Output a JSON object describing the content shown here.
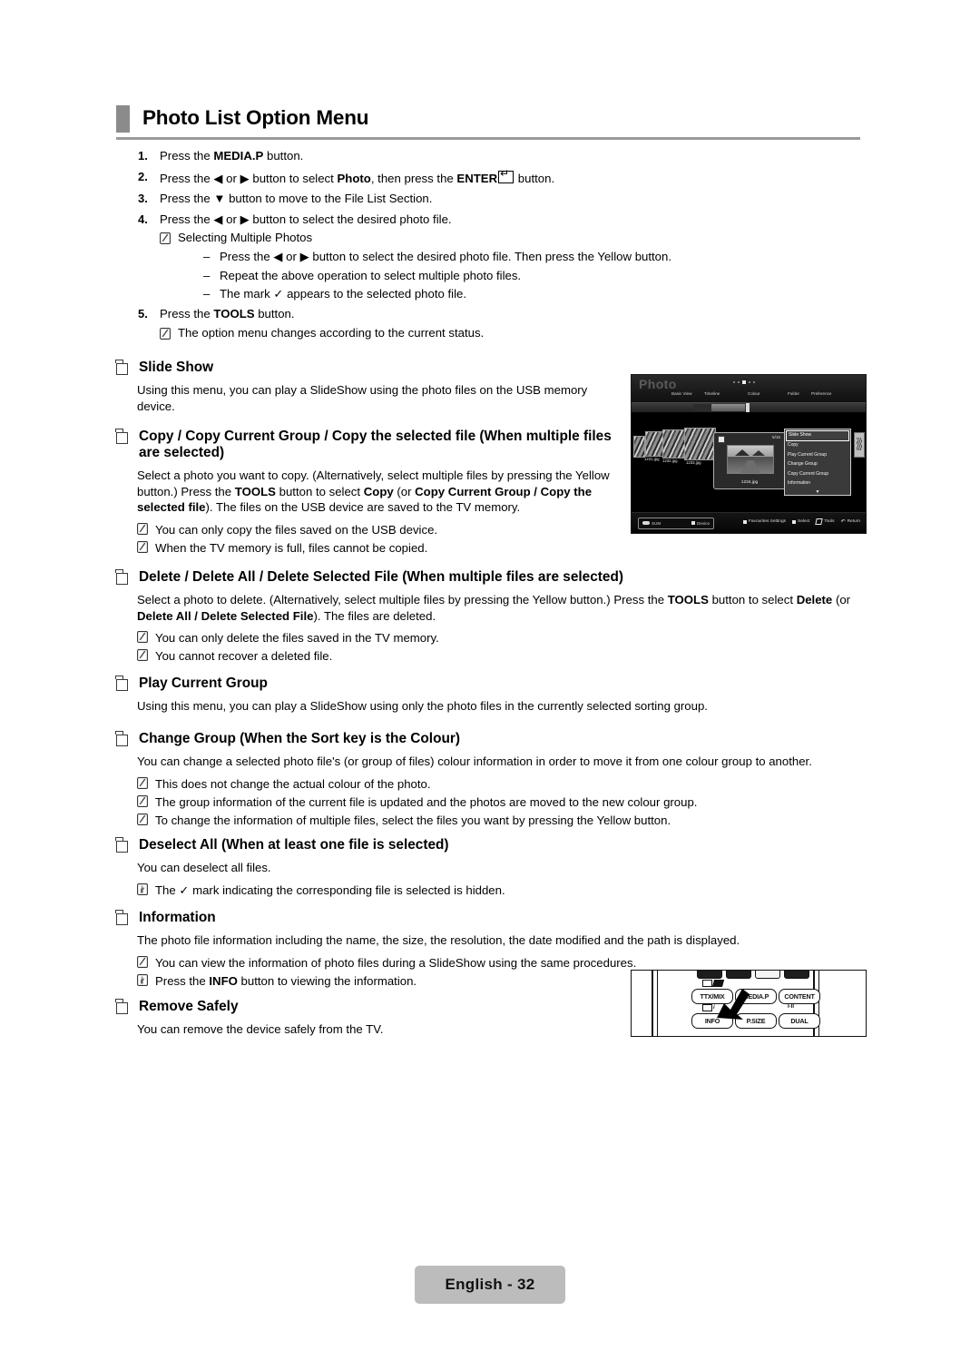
{
  "header": {
    "title": "Photo List Option Menu"
  },
  "steps": [
    {
      "num": "1.",
      "segments": [
        {
          "t": "Press the ",
          "b": false
        },
        {
          "t": "MEDIA.P",
          "b": true
        },
        {
          "t": " button.",
          "b": false
        }
      ]
    },
    {
      "num": "2.",
      "segments": [
        {
          "t": "Press the ",
          "b": false
        },
        {
          "t": "◀",
          "b": false
        },
        {
          "t": " or ",
          "b": false
        },
        {
          "t": "▶",
          "b": false
        },
        {
          "t": " button to select ",
          "b": false
        },
        {
          "t": "Photo",
          "b": true
        },
        {
          "t": ", then press the ",
          "b": false
        },
        {
          "t": "ENTER",
          "b": true
        },
        {
          "t": "ICON_ENTER",
          "b": false
        },
        {
          "t": " button.",
          "b": false
        }
      ]
    },
    {
      "num": "3.",
      "segments": [
        {
          "t": "Press the ",
          "b": false
        },
        {
          "t": "▼",
          "b": false
        },
        {
          "t": " button to move to the File List Section.",
          "b": false
        }
      ]
    },
    {
      "num": "4.",
      "segments": [
        {
          "t": "Press the ",
          "b": false
        },
        {
          "t": "◀",
          "b": false
        },
        {
          "t": " or ",
          "b": false
        },
        {
          "t": "▶",
          "b": false
        },
        {
          "t": " button to select the desired photo file.",
          "b": false
        }
      ]
    }
  ],
  "step4_note": "Selecting Multiple Photos",
  "step4_dashes": [
    "Press the ◀ or ▶ button to select the desired photo file. Then press the Yellow button.",
    "Repeat the above operation to select multiple photo files.",
    "The mark ✓ appears to the selected photo file."
  ],
  "step5": {
    "num": "5.",
    "pre": "Press the ",
    "bold": "TOOLS",
    "post": " button.",
    "note": "The option menu changes according to the current status."
  },
  "sections": [
    {
      "id": "slide-show",
      "title": "Slide Show",
      "body": "Using this menu, you can play a SlideShow using the photo files on the USB memory device.",
      "notes": []
    },
    {
      "id": "copy",
      "title": "Copy / Copy Current Group / Copy the selected file (When multiple files are selected)",
      "body": "Select a photo you want to copy. (Alternatively, select multiple files by pressing the Yellow button.) Press the TOOLS button to select Copy (or Copy Current Group / Copy the selected file). The files on the USB device are saved to the TV memory.",
      "notes": [
        "You can only copy the files saved on the USB device.",
        "When the TV memory is full, files cannot be copied."
      ]
    },
    {
      "id": "delete",
      "title": "Delete / Delete All / Delete Selected File (When multiple files are selected)",
      "body": "Select a photo to delete. (Alternatively, select multiple files by pressing the Yellow button.) Press the TOOLS button to select Delete (or Delete All / Delete Selected File). The files are deleted.",
      "notes": [
        "You can only delete the files saved in the TV memory.",
        "You cannot recover a deleted file."
      ]
    },
    {
      "id": "play-current-group",
      "title": "Play Current Group",
      "body": "Using this menu, you can play a SlideShow using only the photo files in the currently selected sorting group.",
      "notes": []
    },
    {
      "id": "change-group",
      "title": "Change Group (When the Sort key is the Colour)",
      "body": "You can change a selected photo file's (or group of files) colour information in order to move it from one colour group to another.",
      "notes": [
        "This does not change the actual colour of the photo.",
        "The group information of the current file is updated and the photos are moved to the new colour group.",
        "To change the information of multiple files, select the files you want by pressing the Yellow button."
      ]
    },
    {
      "id": "deselect-all",
      "title": "Deselect All (When at least one file is selected)",
      "body": "You can deselect all files.",
      "notes": [
        "The ✓ mark indicating the corresponding file is selected is hidden."
      ]
    },
    {
      "id": "information",
      "title": "Information",
      "body": "The photo file information including the name, the size, the resolution, the date modified and the path is displayed.",
      "notes": [
        "You can view the information of photo files during a SlideShow using the same procedures.",
        "Press the INFO button to viewing the information."
      ]
    },
    {
      "id": "remove-safely",
      "title": "Remove Safely",
      "body": "You can remove the device safely from the TV.",
      "notes": []
    }
  ],
  "tv_screen": {
    "title": "Photo",
    "tabs": [
      "Basic View",
      "Timeline",
      "Colour",
      "Folder",
      "Preference"
    ],
    "selected_tab": "Colour",
    "file_counter": "5/15",
    "thumbnails": [
      "1231.jpg",
      "1232.jpg",
      "1233.jpg"
    ],
    "selected_file": "1234.jpg",
    "menu_items": [
      "Slide Show",
      "Copy",
      "Play Current Group",
      "Change Group",
      "Copy Current Group",
      "Information"
    ],
    "menu_selected": "Slide Show",
    "menu_more": "▼",
    "device_usb": "SUM",
    "device_label": "Device",
    "hints": [
      "Favourites Settings",
      "Select",
      "Tools",
      "Return"
    ]
  },
  "remote": {
    "buttons": [
      "TTX/MIX",
      "MEDIA.P",
      "CONTENT",
      "INFO",
      "P.SIZE",
      "DUAL"
    ],
    "mini_labels": [
      "≡⁄⊘",
      "≡? i",
      "I-II"
    ],
    "highlighted": "MEDIA.P"
  },
  "footer": {
    "page_label": "English - 32"
  }
}
